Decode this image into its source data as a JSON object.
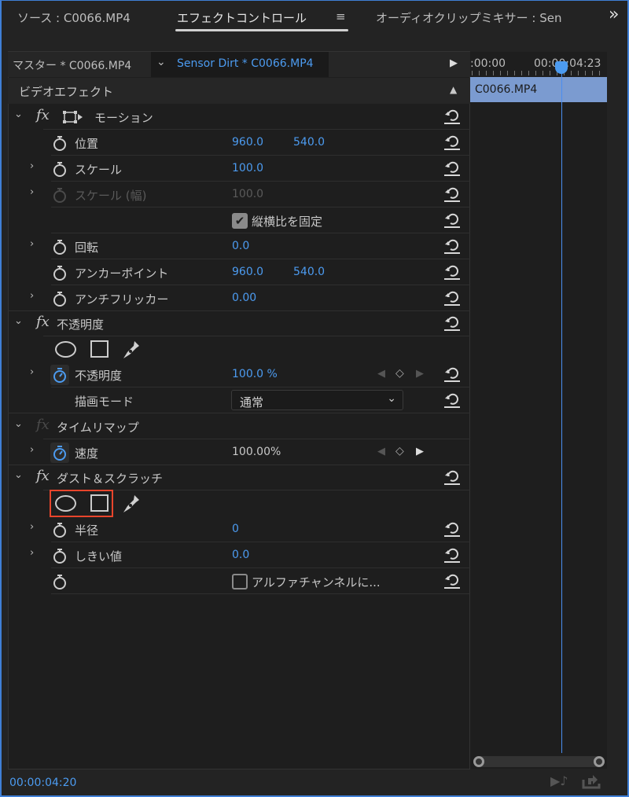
{
  "tabs": {
    "source": "ソース : C0066.MP4",
    "effect_controls": "エフェクトコントロール",
    "menu_icon": "≡",
    "audio_mixer": "オーディオクリップミキサー : Sen",
    "overflow": "»"
  },
  "subheader": {
    "master": "マスター * C0066.MP4",
    "sequence": "Sensor Dirt * C0066.MP4"
  },
  "timeline": {
    "start": ":00:00",
    "current_label": "00:00:04:23",
    "clip": "C0066.MP4"
  },
  "video_effects": "ビデオエフェクト",
  "motion": {
    "name": "モーション",
    "position": {
      "label": "位置",
      "x": "960.0",
      "y": "540.0"
    },
    "scale": {
      "label": "スケール",
      "value": "100.0"
    },
    "scale_width": {
      "label": "スケール (幅)",
      "value": "100.0"
    },
    "uniform_scale": {
      "label": "縦横比を固定",
      "checked": true
    },
    "rotation": {
      "label": "回転",
      "value": "0.0"
    },
    "anchor": {
      "label": "アンカーポイント",
      "x": "960.0",
      "y": "540.0"
    },
    "antiflicker": {
      "label": "アンチフリッカー",
      "value": "0.00"
    }
  },
  "opacity": {
    "name": "不透明度",
    "opacity": {
      "label": "不透明度",
      "value": "100.0 %"
    },
    "blend": {
      "label": "描画モード",
      "value": "通常"
    }
  },
  "time_remap": {
    "name": "タイムリマップ",
    "speed": {
      "label": "速度",
      "value": "100.00%"
    }
  },
  "dust": {
    "name": "ダスト＆スクラッチ",
    "radius": {
      "label": "半径",
      "value": "0"
    },
    "threshold": {
      "label": "しきい値",
      "value": "0.0"
    },
    "alpha": {
      "label": "アルファチャンネルに...",
      "checked": false
    }
  },
  "footer": {
    "timecode": "00:00:04:20"
  },
  "colors": {
    "accent": "#4c9bf0",
    "highlight": "#e8452c",
    "clip": "#7b9bd0"
  }
}
